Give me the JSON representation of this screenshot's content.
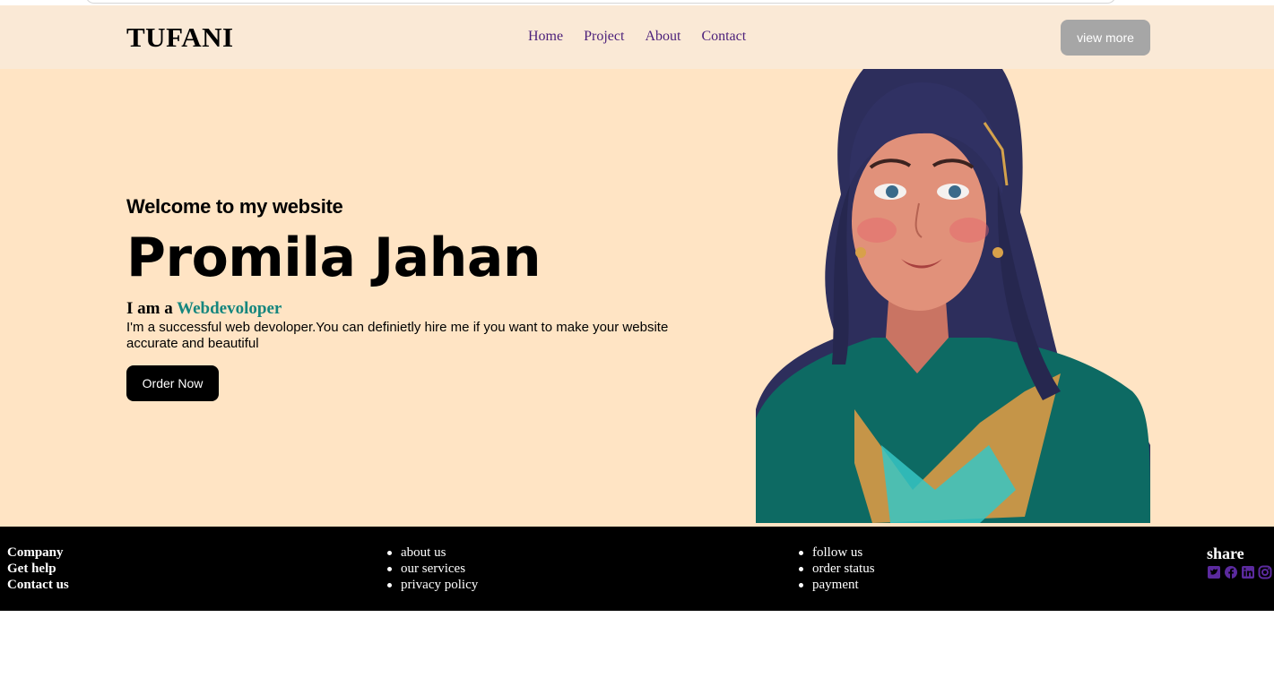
{
  "brand": {
    "logo": "TUFANI"
  },
  "nav": {
    "links": [
      "Home",
      "Project",
      "About",
      "Contact"
    ],
    "cta_label": "view more"
  },
  "hero": {
    "welcome": "Welcome to my website",
    "name": "Promila Jahan",
    "iam_prefix": "I am a",
    "role": "Webdevoloper",
    "bio": "I'm a successful web devoloper.You can definietly hire me if you want to make your website accurate and beautiful",
    "order_label": "Order Now"
  },
  "footer": {
    "col1": [
      "Company",
      "Get help",
      "Contact us"
    ],
    "col2": [
      "about us",
      "our services",
      "privacy policy"
    ],
    "col3": [
      "follow us",
      "order status",
      "payment"
    ],
    "share_title": "share",
    "social_icons": [
      "twitter-icon",
      "facebook-icon",
      "linkedin-icon",
      "instagram-icon"
    ]
  },
  "colors": {
    "nav_bg": "#fae9d6",
    "hero_bg": "#ffe4c4",
    "nav_link": "#4b1f7a",
    "role_accent": "#15867e",
    "footer_bg": "#000000",
    "social_icon": "#5b2a9e"
  }
}
